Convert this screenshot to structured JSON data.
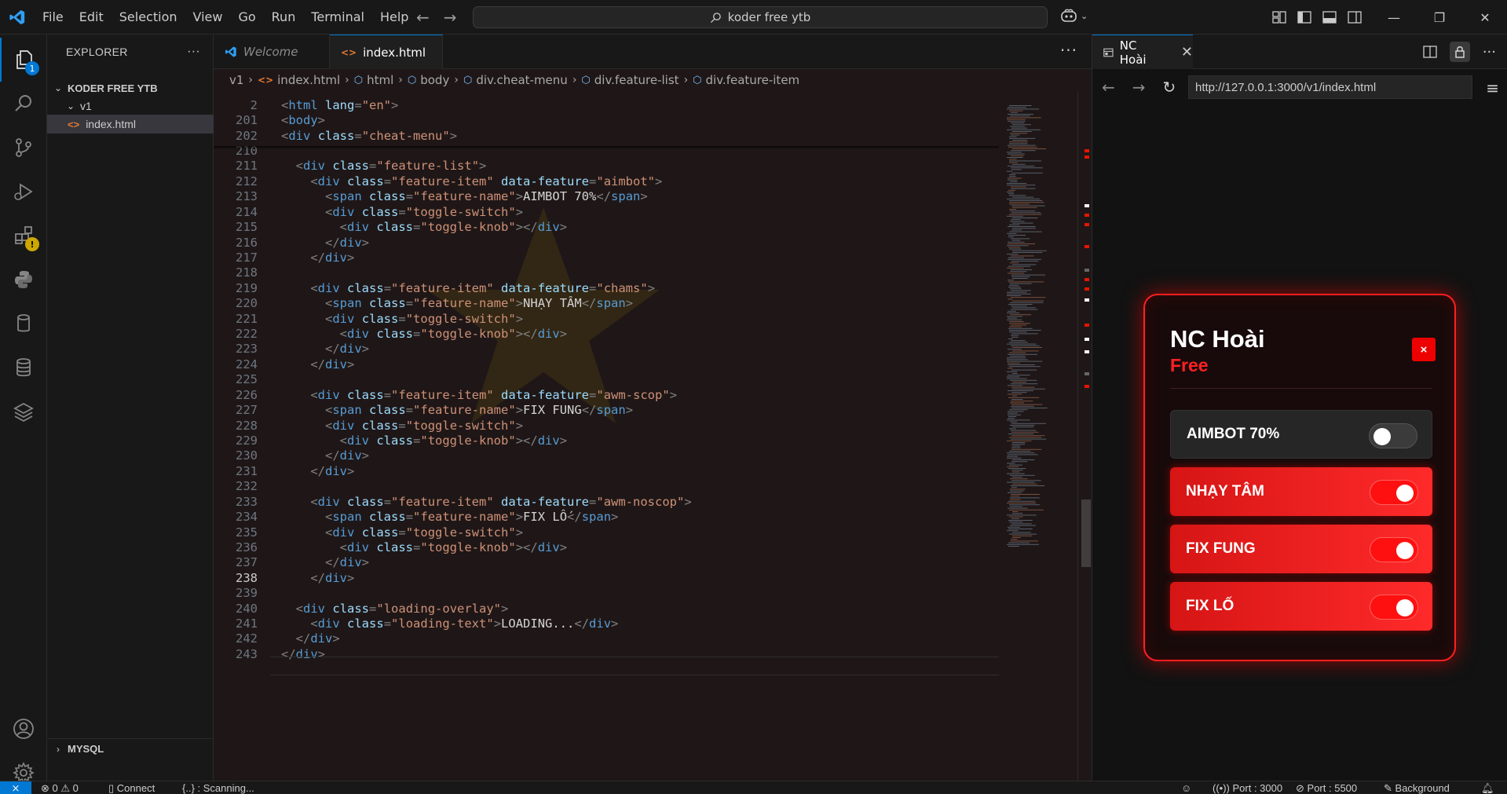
{
  "menu": [
    "File",
    "Edit",
    "Selection",
    "View",
    "Go",
    "Run",
    "Terminal",
    "Help"
  ],
  "search": {
    "label": "koder free ytb"
  },
  "explorer": {
    "title": "EXPLORER",
    "more": "···",
    "root": "KODER FREE YTB",
    "folder": "v1",
    "file": "index.html",
    "mysql": "MYSQL",
    "badge": "1"
  },
  "tabs": [
    {
      "label": "Welcome"
    },
    {
      "label": "index.html"
    }
  ],
  "breadcrumb": [
    "v1",
    "index.html",
    "html",
    "body",
    "div.cheat-menu",
    "div.feature-list",
    "div.feature-item"
  ],
  "code_lines": [
    {
      "n": "2",
      "tokens": [
        [
          "t",
          "<"
        ],
        [
          "tn",
          "html"
        ],
        [
          "x",
          " "
        ],
        [
          "an",
          "lang"
        ],
        [
          "t",
          "="
        ],
        [
          "av",
          "\"en\""
        ],
        [
          "t",
          ">"
        ]
      ]
    },
    {
      "n": "201",
      "tokens": [
        [
          "t",
          "<"
        ],
        [
          "tn",
          "body"
        ],
        [
          "t",
          ">"
        ]
      ]
    },
    {
      "n": "202",
      "tokens": [
        [
          "t",
          "<"
        ],
        [
          "tn",
          "div"
        ],
        [
          "x",
          " "
        ],
        [
          "an",
          "class"
        ],
        [
          "t",
          "="
        ],
        [
          "av",
          "\"cheat-menu\""
        ],
        [
          "t",
          ">"
        ]
      ]
    },
    {
      "n": "210",
      "tokens": []
    },
    {
      "n": "211",
      "tokens": [
        [
          "x",
          "  "
        ],
        [
          "t",
          "<"
        ],
        [
          "tn",
          "div"
        ],
        [
          "x",
          " "
        ],
        [
          "an",
          "class"
        ],
        [
          "t",
          "="
        ],
        [
          "av",
          "\"feature-list\""
        ],
        [
          "t",
          ">"
        ]
      ]
    },
    {
      "n": "212",
      "tokens": [
        [
          "x",
          "    "
        ],
        [
          "t",
          "<"
        ],
        [
          "tn",
          "div"
        ],
        [
          "x",
          " "
        ],
        [
          "an",
          "class"
        ],
        [
          "t",
          "="
        ],
        [
          "av",
          "\"feature-item\""
        ],
        [
          "x",
          " "
        ],
        [
          "an",
          "data-feature"
        ],
        [
          "t",
          "="
        ],
        [
          "av",
          "\"aimbot\""
        ],
        [
          "t",
          ">"
        ]
      ]
    },
    {
      "n": "213",
      "tokens": [
        [
          "x",
          "      "
        ],
        [
          "t",
          "<"
        ],
        [
          "tn",
          "span"
        ],
        [
          "x",
          " "
        ],
        [
          "an",
          "class"
        ],
        [
          "t",
          "="
        ],
        [
          "av",
          "\"feature-name\""
        ],
        [
          "t",
          ">"
        ],
        [
          "tx",
          "AIMBOT 70%"
        ],
        [
          "t",
          "</"
        ],
        [
          "tn",
          "span"
        ],
        [
          "t",
          ">"
        ]
      ]
    },
    {
      "n": "214",
      "tokens": [
        [
          "x",
          "      "
        ],
        [
          "t",
          "<"
        ],
        [
          "tn",
          "div"
        ],
        [
          "x",
          " "
        ],
        [
          "an",
          "class"
        ],
        [
          "t",
          "="
        ],
        [
          "av",
          "\"toggle-switch\""
        ],
        [
          "t",
          ">"
        ]
      ]
    },
    {
      "n": "215",
      "tokens": [
        [
          "x",
          "        "
        ],
        [
          "t",
          "<"
        ],
        [
          "tn",
          "div"
        ],
        [
          "x",
          " "
        ],
        [
          "an",
          "class"
        ],
        [
          "t",
          "="
        ],
        [
          "av",
          "\"toggle-knob\""
        ],
        [
          "t",
          "></"
        ],
        [
          "tn",
          "div"
        ],
        [
          "t",
          ">"
        ]
      ]
    },
    {
      "n": "216",
      "tokens": [
        [
          "x",
          "      "
        ],
        [
          "t",
          "</"
        ],
        [
          "tn",
          "div"
        ],
        [
          "t",
          ">"
        ]
      ]
    },
    {
      "n": "217",
      "tokens": [
        [
          "x",
          "    "
        ],
        [
          "t",
          "</"
        ],
        [
          "tn",
          "div"
        ],
        [
          "t",
          ">"
        ]
      ]
    },
    {
      "n": "218",
      "tokens": []
    },
    {
      "n": "219",
      "tokens": [
        [
          "x",
          "    "
        ],
        [
          "t",
          "<"
        ],
        [
          "tn",
          "div"
        ],
        [
          "x",
          " "
        ],
        [
          "an",
          "class"
        ],
        [
          "t",
          "="
        ],
        [
          "av",
          "\"feature-item\""
        ],
        [
          "x",
          " "
        ],
        [
          "an",
          "data-feature"
        ],
        [
          "t",
          "="
        ],
        [
          "av",
          "\"chams\""
        ],
        [
          "t",
          ">"
        ]
      ]
    },
    {
      "n": "220",
      "tokens": [
        [
          "x",
          "      "
        ],
        [
          "t",
          "<"
        ],
        [
          "tn",
          "span"
        ],
        [
          "x",
          " "
        ],
        [
          "an",
          "class"
        ],
        [
          "t",
          "="
        ],
        [
          "av",
          "\"feature-name\""
        ],
        [
          "t",
          ">"
        ],
        [
          "tx",
          "NHẠY TÂM"
        ],
        [
          "t",
          "</"
        ],
        [
          "tn",
          "span"
        ],
        [
          "t",
          ">"
        ]
      ]
    },
    {
      "n": "221",
      "tokens": [
        [
          "x",
          "      "
        ],
        [
          "t",
          "<"
        ],
        [
          "tn",
          "div"
        ],
        [
          "x",
          " "
        ],
        [
          "an",
          "class"
        ],
        [
          "t",
          "="
        ],
        [
          "av",
          "\"toggle-switch\""
        ],
        [
          "t",
          ">"
        ]
      ]
    },
    {
      "n": "222",
      "tokens": [
        [
          "x",
          "        "
        ],
        [
          "t",
          "<"
        ],
        [
          "tn",
          "div"
        ],
        [
          "x",
          " "
        ],
        [
          "an",
          "class"
        ],
        [
          "t",
          "="
        ],
        [
          "av",
          "\"toggle-knob\""
        ],
        [
          "t",
          "></"
        ],
        [
          "tn",
          "div"
        ],
        [
          "t",
          ">"
        ]
      ]
    },
    {
      "n": "223",
      "tokens": [
        [
          "x",
          "      "
        ],
        [
          "t",
          "</"
        ],
        [
          "tn",
          "div"
        ],
        [
          "t",
          ">"
        ]
      ]
    },
    {
      "n": "224",
      "tokens": [
        [
          "x",
          "    "
        ],
        [
          "t",
          "</"
        ],
        [
          "tn",
          "div"
        ],
        [
          "t",
          ">"
        ]
      ]
    },
    {
      "n": "225",
      "tokens": []
    },
    {
      "n": "226",
      "tokens": [
        [
          "x",
          "    "
        ],
        [
          "t",
          "<"
        ],
        [
          "tn",
          "div"
        ],
        [
          "x",
          " "
        ],
        [
          "an",
          "class"
        ],
        [
          "t",
          "="
        ],
        [
          "av",
          "\"feature-item\""
        ],
        [
          "x",
          " "
        ],
        [
          "an",
          "data-feature"
        ],
        [
          "t",
          "="
        ],
        [
          "av",
          "\"awm-scop\""
        ],
        [
          "t",
          ">"
        ]
      ]
    },
    {
      "n": "227",
      "tokens": [
        [
          "x",
          "      "
        ],
        [
          "t",
          "<"
        ],
        [
          "tn",
          "span"
        ],
        [
          "x",
          " "
        ],
        [
          "an",
          "class"
        ],
        [
          "t",
          "="
        ],
        [
          "av",
          "\"feature-name\""
        ],
        [
          "t",
          ">"
        ],
        [
          "tx",
          "FIX FUNG"
        ],
        [
          "t",
          "</"
        ],
        [
          "tn",
          "span"
        ],
        [
          "t",
          ">"
        ]
      ]
    },
    {
      "n": "228",
      "tokens": [
        [
          "x",
          "      "
        ],
        [
          "t",
          "<"
        ],
        [
          "tn",
          "div"
        ],
        [
          "x",
          " "
        ],
        [
          "an",
          "class"
        ],
        [
          "t",
          "="
        ],
        [
          "av",
          "\"toggle-switch\""
        ],
        [
          "t",
          ">"
        ]
      ]
    },
    {
      "n": "229",
      "tokens": [
        [
          "x",
          "        "
        ],
        [
          "t",
          "<"
        ],
        [
          "tn",
          "div"
        ],
        [
          "x",
          " "
        ],
        [
          "an",
          "class"
        ],
        [
          "t",
          "="
        ],
        [
          "av",
          "\"toggle-knob\""
        ],
        [
          "t",
          "></"
        ],
        [
          "tn",
          "div"
        ],
        [
          "t",
          ">"
        ]
      ]
    },
    {
      "n": "230",
      "tokens": [
        [
          "x",
          "      "
        ],
        [
          "t",
          "</"
        ],
        [
          "tn",
          "div"
        ],
        [
          "t",
          ">"
        ]
      ]
    },
    {
      "n": "231",
      "tokens": [
        [
          "x",
          "    "
        ],
        [
          "t",
          "</"
        ],
        [
          "tn",
          "div"
        ],
        [
          "t",
          ">"
        ]
      ]
    },
    {
      "n": "232",
      "tokens": []
    },
    {
      "n": "233",
      "tokens": [
        [
          "x",
          "    "
        ],
        [
          "t",
          "<"
        ],
        [
          "tn",
          "div"
        ],
        [
          "x",
          " "
        ],
        [
          "an",
          "class"
        ],
        [
          "t",
          "="
        ],
        [
          "av",
          "\"feature-item\""
        ],
        [
          "x",
          " "
        ],
        [
          "an",
          "data-feature"
        ],
        [
          "t",
          "="
        ],
        [
          "av",
          "\"awm-noscop\""
        ],
        [
          "t",
          ">"
        ]
      ]
    },
    {
      "n": "234",
      "tokens": [
        [
          "x",
          "      "
        ],
        [
          "t",
          "<"
        ],
        [
          "tn",
          "span"
        ],
        [
          "x",
          " "
        ],
        [
          "an",
          "class"
        ],
        [
          "t",
          "="
        ],
        [
          "av",
          "\"feature-name\""
        ],
        [
          "t",
          ">"
        ],
        [
          "tx",
          "FIX LỐ"
        ],
        [
          "t",
          "</"
        ],
        [
          "tn",
          "span"
        ],
        [
          "t",
          ">"
        ]
      ]
    },
    {
      "n": "235",
      "tokens": [
        [
          "x",
          "      "
        ],
        [
          "t",
          "<"
        ],
        [
          "tn",
          "div"
        ],
        [
          "x",
          " "
        ],
        [
          "an",
          "class"
        ],
        [
          "t",
          "="
        ],
        [
          "av",
          "\"toggle-switch\""
        ],
        [
          "t",
          ">"
        ]
      ]
    },
    {
      "n": "236",
      "tokens": [
        [
          "x",
          "        "
        ],
        [
          "t",
          "<"
        ],
        [
          "tn",
          "div"
        ],
        [
          "x",
          " "
        ],
        [
          "an",
          "class"
        ],
        [
          "t",
          "="
        ],
        [
          "av",
          "\"toggle-knob\""
        ],
        [
          "t",
          "></"
        ],
        [
          "tn",
          "div"
        ],
        [
          "t",
          ">"
        ]
      ]
    },
    {
      "n": "237",
      "tokens": [
        [
          "x",
          "      "
        ],
        [
          "t",
          "</"
        ],
        [
          "tn",
          "div"
        ],
        [
          "t",
          ">"
        ]
      ]
    },
    {
      "n": "238",
      "tokens": [
        [
          "x",
          "    "
        ],
        [
          "t",
          "</"
        ],
        [
          "tn",
          "div"
        ],
        [
          "t",
          ">"
        ]
      ]
    },
    {
      "n": "239",
      "tokens": []
    },
    {
      "n": "240",
      "tokens": [
        [
          "x",
          "  "
        ],
        [
          "t",
          "<"
        ],
        [
          "tn",
          "div"
        ],
        [
          "x",
          " "
        ],
        [
          "an",
          "class"
        ],
        [
          "t",
          "="
        ],
        [
          "av",
          "\"loading-overlay\""
        ],
        [
          "t",
          ">"
        ]
      ]
    },
    {
      "n": "241",
      "tokens": [
        [
          "x",
          "    "
        ],
        [
          "t",
          "<"
        ],
        [
          "tn",
          "div"
        ],
        [
          "x",
          " "
        ],
        [
          "an",
          "class"
        ],
        [
          "t",
          "="
        ],
        [
          "av",
          "\"loading-text\""
        ],
        [
          "t",
          ">"
        ],
        [
          "tx",
          "LOADING..."
        ],
        [
          "t",
          "</"
        ],
        [
          "tn",
          "div"
        ],
        [
          "t",
          ">"
        ]
      ]
    },
    {
      "n": "242",
      "tokens": [
        [
          "x",
          "  "
        ],
        [
          "t",
          "</"
        ],
        [
          "tn",
          "div"
        ],
        [
          "t",
          ">"
        ]
      ]
    },
    {
      "n": "243",
      "tokens": [
        [
          "t",
          "</"
        ],
        [
          "tn",
          "div"
        ],
        [
          "t",
          ">"
        ]
      ]
    }
  ],
  "current_line": "238",
  "browser": {
    "tab_title": "NC Hoài",
    "url": "http://127.0.0.1:3000/v1/index.html"
  },
  "cheat_menu": {
    "title": "NC Hoài",
    "subtitle": "Free",
    "close": "×",
    "features": [
      {
        "name": "AIMBOT 70%",
        "enabled": false
      },
      {
        "name": "NHẠY TÂM",
        "enabled": true
      },
      {
        "name": "FIX FUNG",
        "enabled": true
      },
      {
        "name": "FIX LỐ",
        "enabled": true
      }
    ]
  },
  "statusbar": {
    "errors": "0",
    "warnings": "0",
    "connect": "Connect",
    "scanning": "{..} : Scanning...",
    "port1": "Port : 3000",
    "port2": "Port : 5500",
    "background": "Background"
  },
  "colors": {
    "accent": "#0078d4",
    "cheat_red": "#ff1f1f"
  }
}
